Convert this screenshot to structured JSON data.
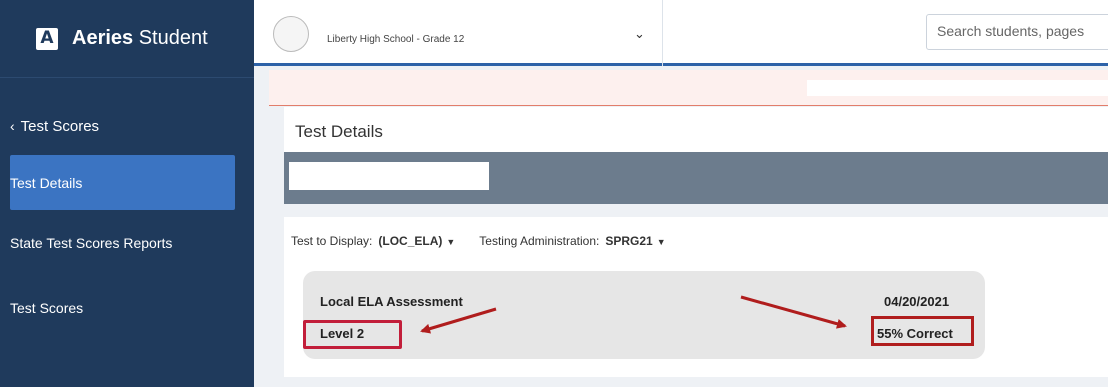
{
  "app": {
    "brand_bold": "Aeries",
    "brand_rest": "Student",
    "logo_letter": "A"
  },
  "sidebar": {
    "back_label": "Test Scores",
    "items": [
      {
        "label": "Test Details",
        "active": true
      },
      {
        "label": "State Test Scores Reports",
        "active": false
      },
      {
        "label": "Test Scores",
        "active": false
      }
    ]
  },
  "header": {
    "school": "Liberty High School - Grade 12",
    "search_placeholder": "Search students, pages"
  },
  "page": {
    "title": "Test Details"
  },
  "filters": {
    "test_label": "Test to Display:",
    "test_value": "(LOC_ELA)",
    "admin_label": "Testing Administration:",
    "admin_value": "SPRG21"
  },
  "card": {
    "title": "Local ELA Assessment",
    "level": "Level 2",
    "date": "04/20/2021",
    "percent": "55% Correct"
  },
  "colors": {
    "sidebar_bg": "#1f3a5c",
    "sidebar_active": "#3b74c2",
    "accent_border": "#2d62a8",
    "highlight_red": "#c21e3a"
  }
}
